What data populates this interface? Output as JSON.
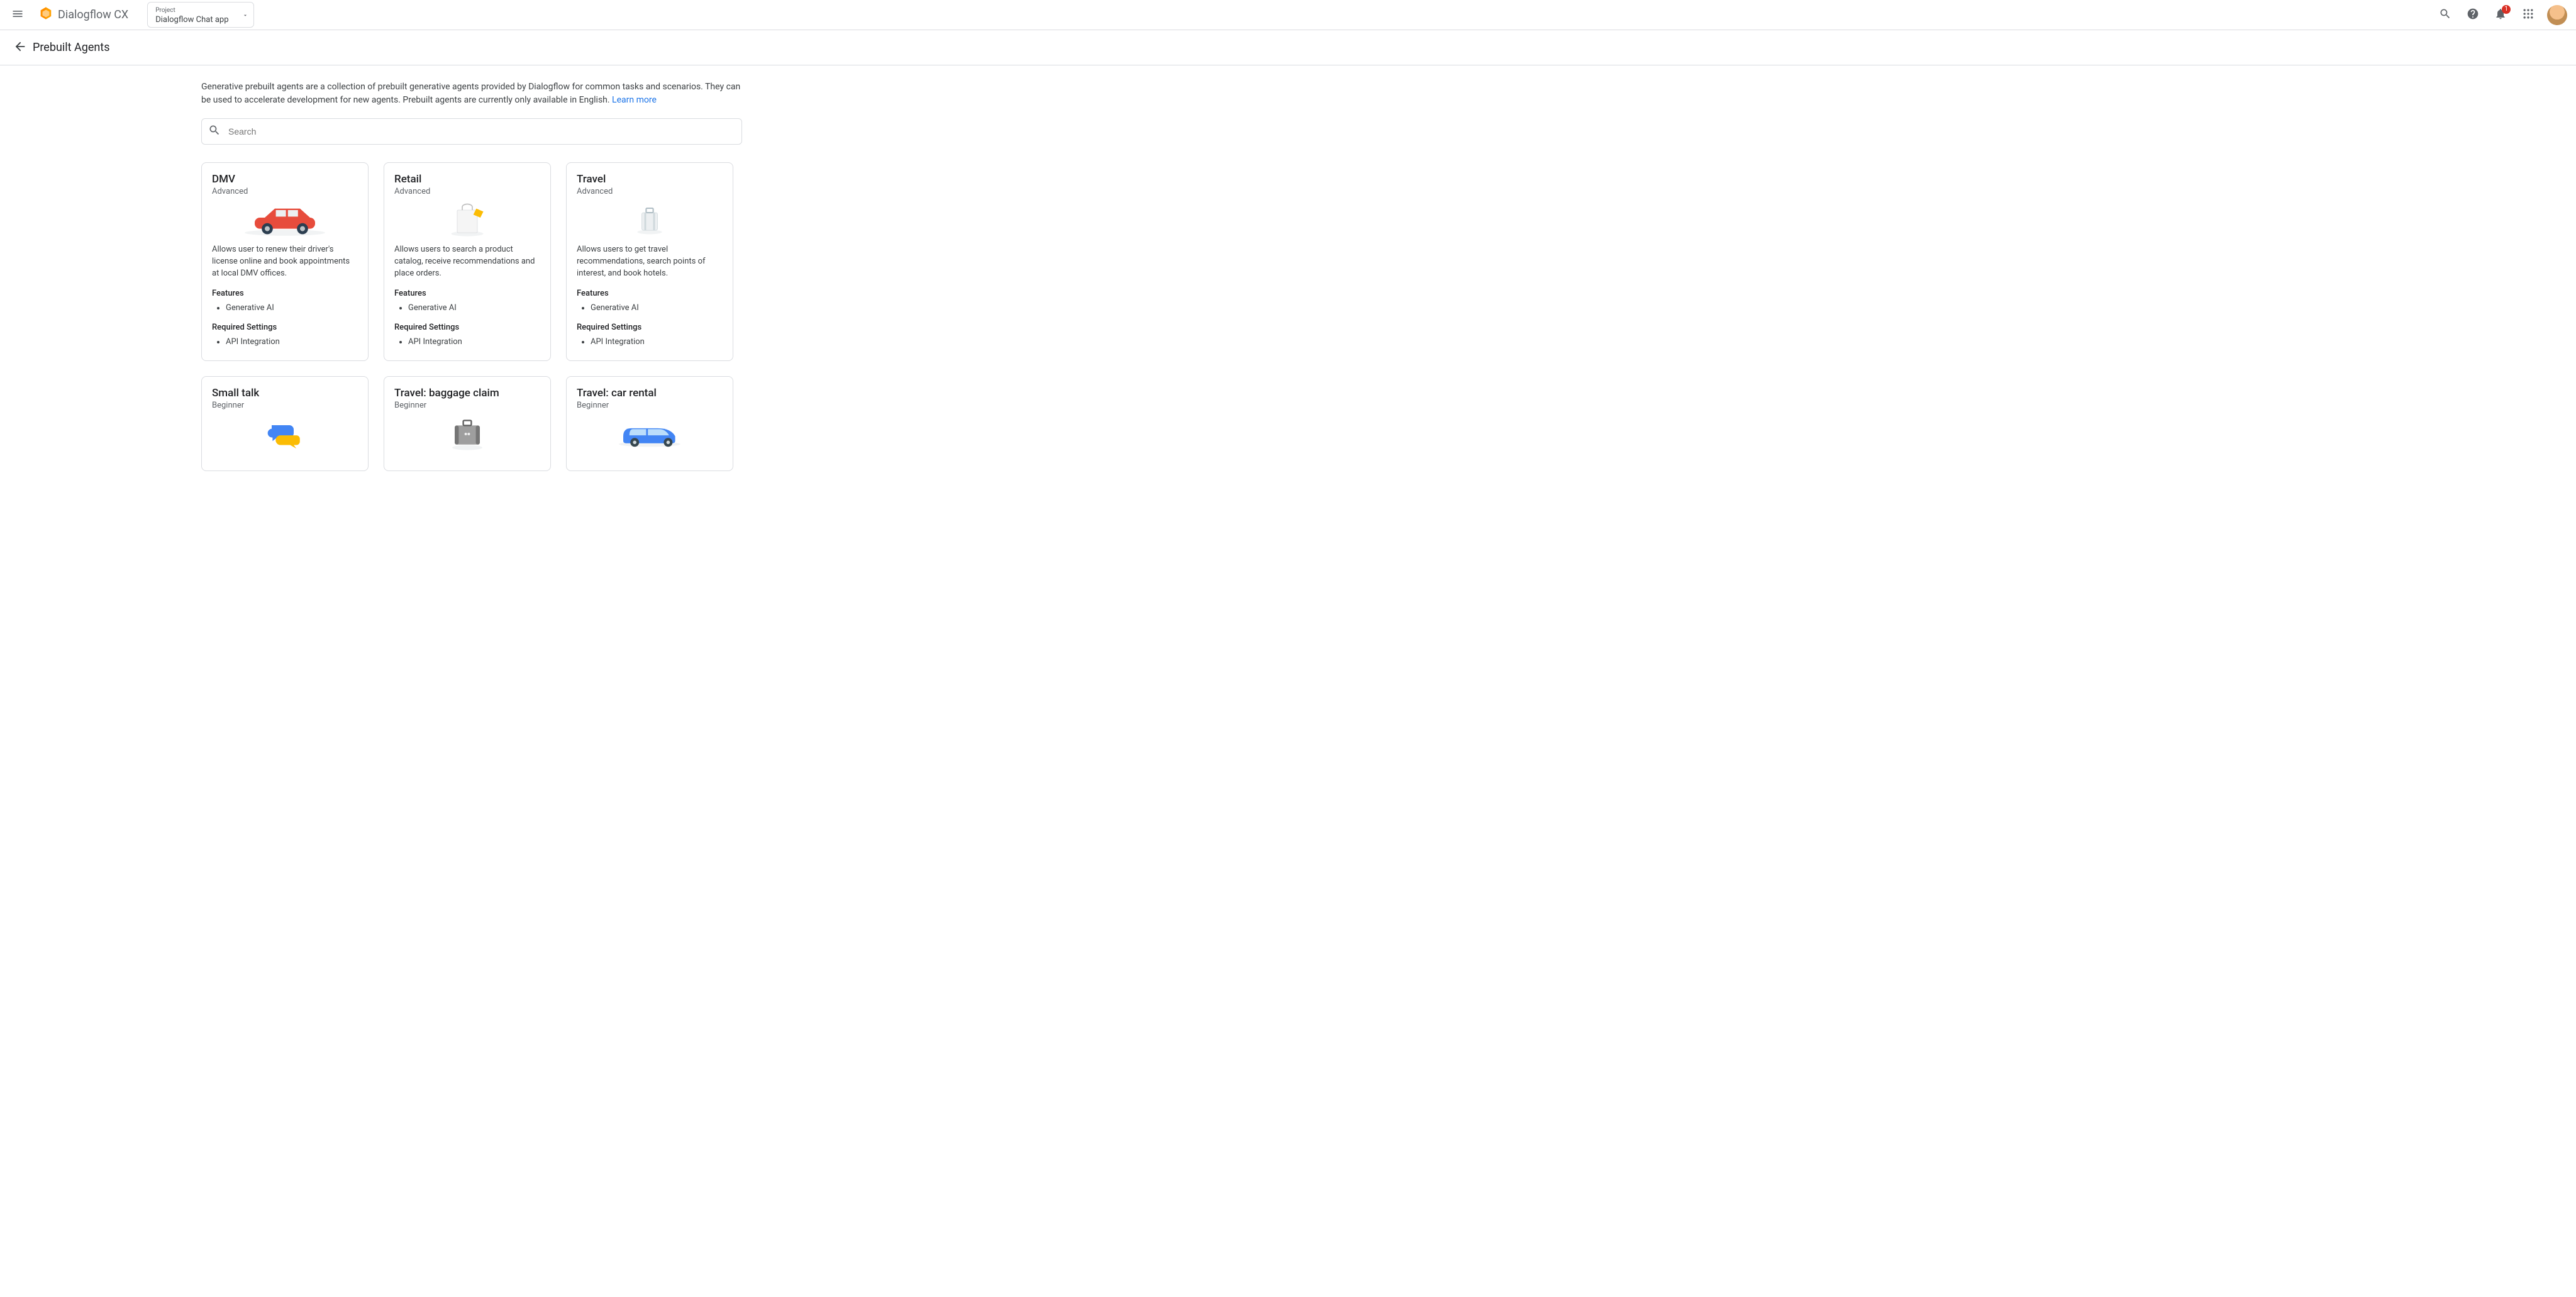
{
  "app": {
    "product_name": "Dialogflow CX",
    "project_label": "Project",
    "project_value": "Dialogflow Chat app",
    "notification_count": "1"
  },
  "section": {
    "title": "Prebuilt Agents"
  },
  "intro": {
    "text": "Generative prebuilt agents are a collection of prebuilt generative agents provided by Dialogflow for common tasks and scenarios. They can be used to accelerate development for new agents. Prebuilt agents are currently only available in English. ",
    "learn_more": "Learn more"
  },
  "search": {
    "placeholder": "Search",
    "value": ""
  },
  "labels": {
    "features": "Features",
    "required_settings": "Required Settings"
  },
  "agents": [
    {
      "id": "dmv",
      "title": "DMV",
      "level": "Advanced",
      "desc": "Allows user to renew their driver's license online and book appointments at local DMV offices.",
      "features": [
        "Generative AI"
      ],
      "required": [
        "API Integration"
      ]
    },
    {
      "id": "retail",
      "title": "Retail",
      "level": "Advanced",
      "desc": "Allows users to search a product catalog, receive recommendations and place orders.",
      "features": [
        "Generative AI"
      ],
      "required": [
        "API Integration"
      ]
    },
    {
      "id": "travel",
      "title": "Travel",
      "level": "Advanced",
      "desc": "Allows users to get travel recommendations, search points of interest, and book hotels.",
      "features": [
        "Generative AI"
      ],
      "required": [
        "API Integration"
      ]
    },
    {
      "id": "small-talk",
      "title": "Small talk",
      "level": "Beginner",
      "desc": "",
      "features": [],
      "required": []
    },
    {
      "id": "travel-baggage",
      "title": "Travel: baggage claim",
      "level": "Beginner",
      "desc": "",
      "features": [],
      "required": []
    },
    {
      "id": "travel-car-rental",
      "title": "Travel: car rental",
      "level": "Beginner",
      "desc": "",
      "features": [],
      "required": []
    }
  ]
}
